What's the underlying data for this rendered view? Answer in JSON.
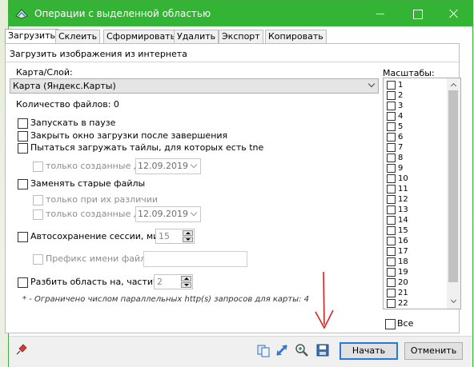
{
  "window": {
    "title": "Операции с выделенной областью"
  },
  "tabs": [
    {
      "label": "Загрузить",
      "active": true
    },
    {
      "label": "Склеить"
    },
    {
      "label": "Сформировать"
    },
    {
      "label": "Удалить"
    },
    {
      "label": "Экспорт"
    },
    {
      "label": "Копировать"
    }
  ],
  "panel": {
    "header": "Загрузить изображения из интернета",
    "map_layer_label": "Карта/Слой:",
    "map_layer_value": "Карта (Яндекс.Карты)",
    "file_count": "Количество файлов: 0",
    "start_paused": "Запускать в паузе",
    "close_after": "Закрыть окно загрузки после завершения",
    "try_tne": "Пытаться загружать тайлы, для которых есть tne",
    "only_created_before_1": "только созданные до",
    "date_1": "12.09.2019",
    "replace_old": "Заменять старые файлы",
    "only_if_different": "только при их различии",
    "only_created_before_2": "только созданные до",
    "date_2": "12.09.2019",
    "autosave": "Автосохранение сессии, мин:",
    "autosave_value": "15",
    "file_prefix": "Префикс имени файла:",
    "split": "Разбить область на, части*:",
    "split_value": "2",
    "note": "* - Ограничено числом параллельных http(s) запросов для карты: 4"
  },
  "scales": {
    "label": "Масштабы:",
    "items": [
      "1",
      "2",
      "3",
      "4",
      "5",
      "6",
      "7",
      "8",
      "9",
      "10",
      "11",
      "12",
      "13",
      "14",
      "15",
      "16",
      "17",
      "18",
      "19",
      "20",
      "21",
      "22"
    ],
    "all_label": "Все"
  },
  "footer": {
    "start": "Начать",
    "cancel": "Отменить"
  },
  "colors": {
    "titlebar": "#34b434",
    "default_button_border": "#2a78d6",
    "arrow": "#e02020"
  }
}
